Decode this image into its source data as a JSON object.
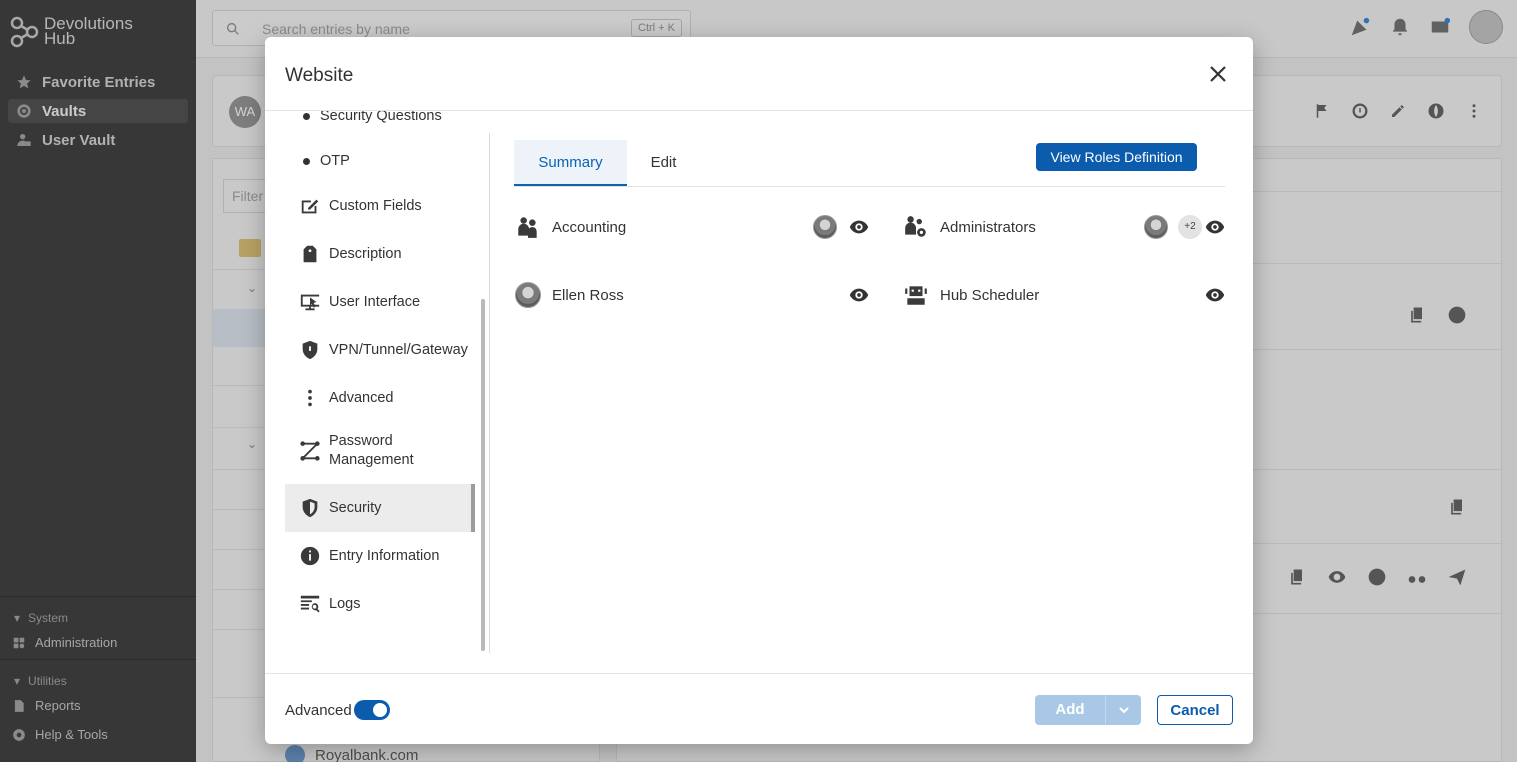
{
  "app": {
    "brand_line1": "Devolutions",
    "brand_line2": "Hub",
    "nav": [
      {
        "label": "Favorite Entries",
        "icon": "star-icon"
      },
      {
        "label": "Vaults",
        "icon": "vault-icon"
      },
      {
        "label": "User Vault",
        "icon": "user-vault-icon"
      }
    ],
    "system_group": "System",
    "administration": "Administration",
    "utilities_group": "Utilities",
    "reports": "Reports",
    "help_tools": "Help & Tools",
    "search_placeholder": "Search entries by name",
    "search_shortcut": "Ctrl + K",
    "entry_initials": "WA",
    "filter_placeholder": "Filter",
    "bg_entry": "Royalbank.com"
  },
  "modal": {
    "title": "Website",
    "left_nav": [
      {
        "label": "Security Questions",
        "icon": "bullet"
      },
      {
        "label": "OTP",
        "icon": "bullet"
      },
      {
        "label": "Custom Fields",
        "icon": "custom-fields-icon"
      },
      {
        "label": "Description",
        "icon": "description-icon"
      },
      {
        "label": "User Interface",
        "icon": "user-interface-icon"
      },
      {
        "label": "VPN/Tunnel/Gateway",
        "icon": "vpn-shield-icon"
      },
      {
        "label": "Advanced",
        "icon": "more-vertical-icon"
      },
      {
        "label": "Password Management",
        "icon": "password-management-icon"
      },
      {
        "label": "Security",
        "icon": "security-shield-icon",
        "selected": true
      },
      {
        "label": "Entry Information",
        "icon": "info-icon"
      },
      {
        "label": "Logs",
        "icon": "logs-icon"
      }
    ],
    "tabs": [
      {
        "label": "Summary",
        "active": true
      },
      {
        "label": "Edit",
        "active": false
      }
    ],
    "view_roles_button": "View Roles Definition",
    "roles": [
      {
        "name": "Accounting",
        "icon": "user-group-icon",
        "extra": ""
      },
      {
        "name": "Administrators",
        "icon": "admin-group-icon",
        "extra": "+2"
      },
      {
        "name": "Ellen Ross",
        "icon": "user-avatar",
        "extra": ""
      },
      {
        "name": "Hub Scheduler",
        "icon": "robot-icon",
        "extra": ""
      }
    ],
    "footer": {
      "advanced_label": "Advanced",
      "advanced_on": true,
      "add_button": "Add",
      "cancel_button": "Cancel"
    }
  }
}
